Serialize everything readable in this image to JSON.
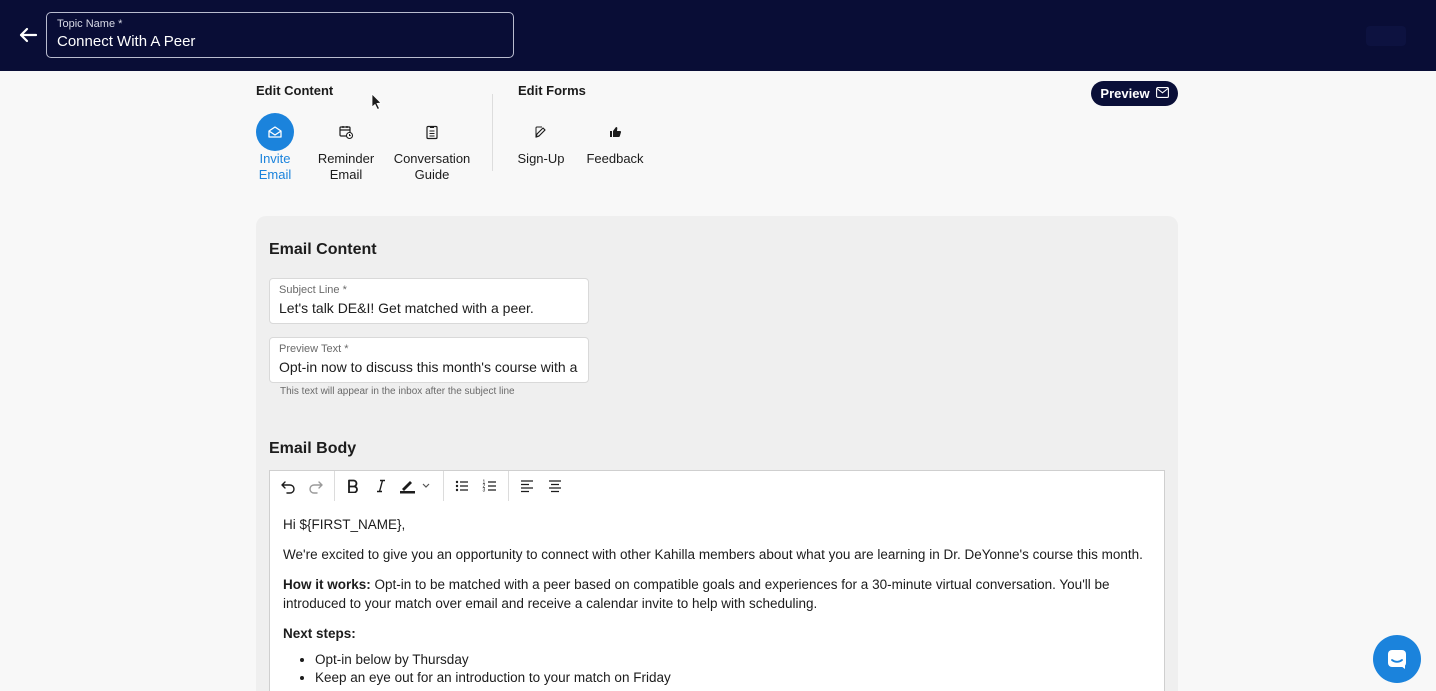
{
  "header": {
    "topic_label": "Topic Name *",
    "topic_value": "Connect With A Peer"
  },
  "edit_content": {
    "title": "Edit Content",
    "tabs": [
      {
        "label_1": "Invite",
        "label_2": "Email",
        "icon": "envelope-open-icon",
        "active": true
      },
      {
        "label_1": "Reminder",
        "label_2": "Email",
        "icon": "calendar-clock-icon"
      },
      {
        "label_1": "Conversation",
        "label_2": "Guide",
        "icon": "clipboard-icon"
      }
    ]
  },
  "edit_forms": {
    "title": "Edit Forms",
    "tabs": [
      {
        "label_1": "Sign-Up",
        "icon": "edit-icon"
      },
      {
        "label_1": "Feedback",
        "icon": "thumbs-up-icon"
      }
    ]
  },
  "preview_label": "Preview",
  "email_content": {
    "title": "Email Content",
    "subject_label": "Subject Line *",
    "subject_value": "Let's talk DE&I! Get matched with a peer.",
    "preview_label": "Preview Text *",
    "preview_value": "Opt-in now to discuss this month's course with a",
    "preview_helper": "This text will appear in the inbox after the subject line"
  },
  "email_body": {
    "title": "Email Body",
    "greeting": "Hi ${FIRST_NAME},",
    "intro": "We're excited to give you an opportunity to connect with other Kahilla members about what you are learning in Dr. DeYonne's course this month.",
    "how_label": "How it works:",
    "how_text": " Opt-in to be matched with a peer based on compatible goals and experiences for a 30-minute virtual conversation. You'll be introduced to your match over email and receive a calendar invite to help with scheduling.",
    "next_label": "Next steps:",
    "steps": [
      "Opt-in below by Thursday",
      "Keep an eye out for an introduction to your match on Friday"
    ]
  },
  "colors": {
    "nav": "#090d36",
    "accent": "#1b83dc"
  }
}
